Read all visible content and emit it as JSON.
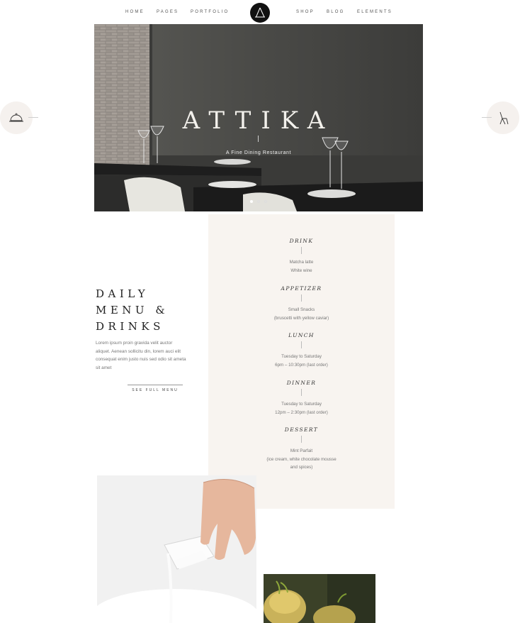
{
  "nav": {
    "left": [
      "HOME",
      "PAGES",
      "PORTFOLIO"
    ],
    "right": [
      "SHOP",
      "BLOG",
      "ELEMENTS"
    ],
    "logo_icon": "attika-logo-icon"
  },
  "hero": {
    "title": "ATTIKA",
    "subtitle": "A Fine Dining Restaurant",
    "slides": 3,
    "active_slide": 1
  },
  "side_buttons": {
    "left_icon": "cloche-icon",
    "right_icon": "chair-icon"
  },
  "daily": {
    "title_lines": [
      "DAILY",
      "MENU &",
      "DRINKS"
    ],
    "text": "Lorem ipsum proin gravida velit auctor aliquet. Aenean sollicitu din, lorem auci elit consequat enim justo nuis sed odio sit ameta sit amet",
    "button": "SEE FULL MENU"
  },
  "menu": [
    {
      "title": "DRINK",
      "items": [
        "Matcha latte",
        "White wine"
      ]
    },
    {
      "title": "APPETIZER",
      "items": [
        "Small Snacks",
        "(bruscetti with yellow caviar)"
      ]
    },
    {
      "title": "LUNCH",
      "items": [
        "Tuesday to Saturday",
        "6pm – 10:30pm (last order)"
      ]
    },
    {
      "title": "DINNER",
      "items": [
        "Tuesday to Saturday",
        "12pm – 2:30pm (last order)"
      ]
    },
    {
      "title": "DESSERT",
      "items": [
        "Mint Parfait",
        "(ice cream, white chocolate mousse",
        "and spices)"
      ]
    }
  ],
  "colors": {
    "panel_bg": "#f8f4f0",
    "side_btn_bg": "#f5f1ee",
    "hero_wall": "#4b4b48"
  }
}
